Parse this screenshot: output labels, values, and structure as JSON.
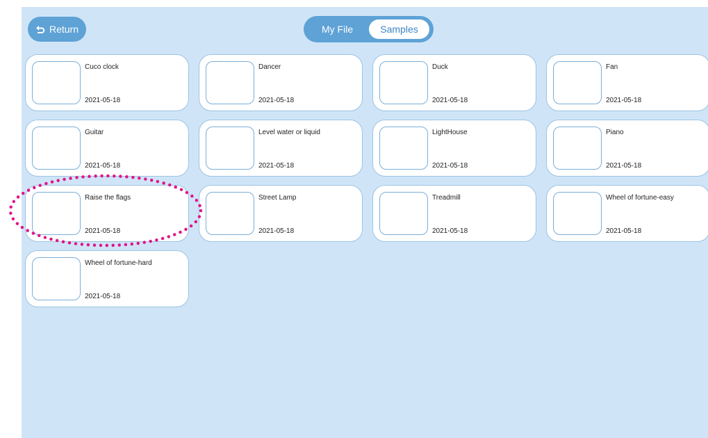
{
  "header": {
    "return_label": "Return",
    "tabs": [
      {
        "label": "My File",
        "selected": false
      },
      {
        "label": "Samples",
        "selected": true
      }
    ]
  },
  "samples": [
    {
      "title": "Cuco clock",
      "date": "2021-05-18"
    },
    {
      "title": "Dancer",
      "date": "2021-05-18"
    },
    {
      "title": "Duck",
      "date": "2021-05-18"
    },
    {
      "title": "Fan",
      "date": "2021-05-18"
    },
    {
      "title": "Guitar",
      "date": "2021-05-18"
    },
    {
      "title": "Level water or liquid",
      "date": "2021-05-18"
    },
    {
      "title": "LightHouse",
      "date": "2021-05-18"
    },
    {
      "title": "Piano",
      "date": "2021-05-18"
    },
    {
      "title": "Raise the flags",
      "date": "2021-05-18"
    },
    {
      "title": "Street Lamp",
      "date": "2021-05-18"
    },
    {
      "title": "Treadmill",
      "date": "2021-05-18"
    },
    {
      "title": "Wheel of fortune-easy",
      "date": "2021-05-18"
    },
    {
      "title": "Wheel of fortune-hard",
      "date": "2021-05-18"
    }
  ],
  "colors": {
    "background": "#cfe5f7",
    "accent": "#5ea2d6",
    "card_border": "#9cc3e3",
    "highlight": "#e0158a"
  }
}
